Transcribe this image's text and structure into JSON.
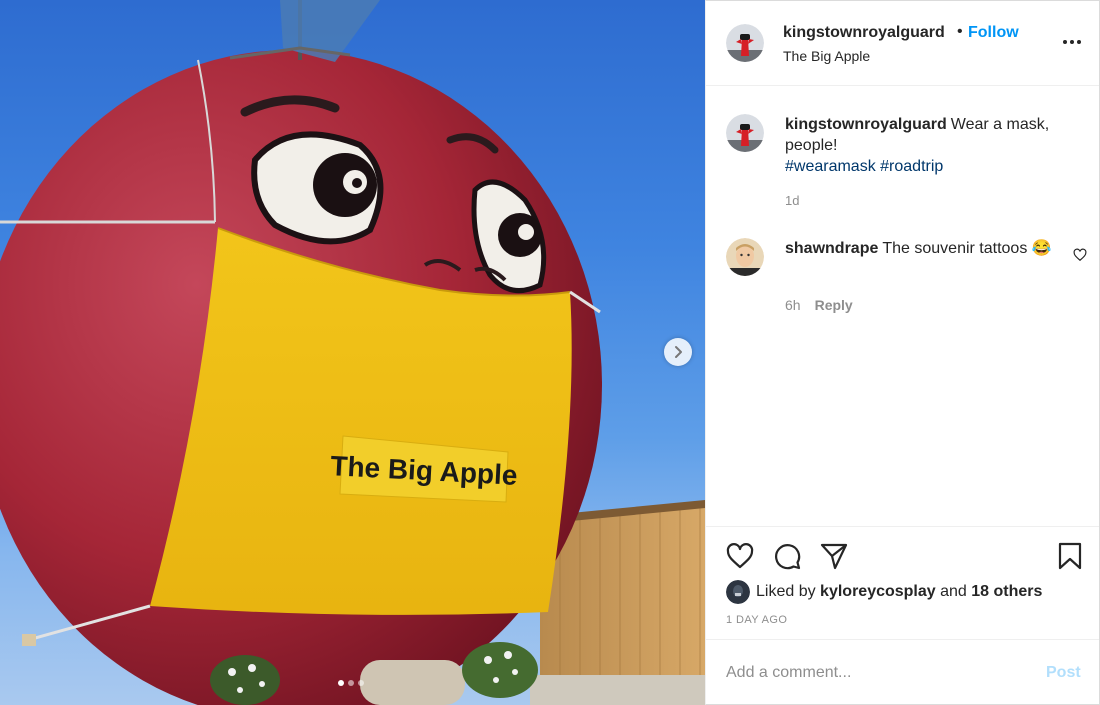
{
  "post": {
    "username": "kingstownroyalguard",
    "separator": "•",
    "follow_label": "Follow",
    "location": "The Big Apple",
    "more_icon": "more-options-icon"
  },
  "media": {
    "sign_text": "The Big Apple",
    "next_icon": "chevron-right-icon",
    "carousel_dots": 3,
    "active_dot": 1
  },
  "caption": {
    "username": "kingstownroyalguard",
    "text": "Wear a mask, people!",
    "hashtags": "#wearamask #roadtrip",
    "time": "1d"
  },
  "comments": [
    {
      "username": "shawndrape",
      "text": "The souvenir tattoos 😂",
      "time": "6h",
      "reply_label": "Reply"
    }
  ],
  "actions": {
    "liked_prefix": "Liked by",
    "liked_user": "kyloreycosplay",
    "liked_and": "and",
    "liked_others": "18 others",
    "timestamp": "1 DAY AGO"
  },
  "composer": {
    "placeholder": "Add a comment...",
    "post_label": "Post"
  },
  "colors": {
    "link_blue": "#0095f6",
    "hashtag_blue": "#00376b",
    "muted_gray": "#8e8e8e",
    "post_disabled": "#b2dffc"
  }
}
